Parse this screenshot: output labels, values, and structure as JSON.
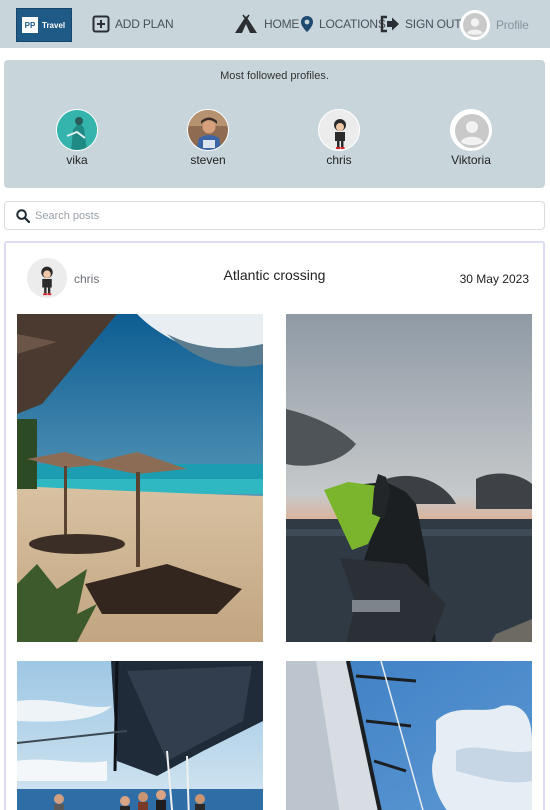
{
  "nav": {
    "logo_mark": "PP",
    "logo_text": "Travel",
    "add_plan": "ADD PLAN",
    "home": "HOME",
    "locations": "LOCATIONS",
    "sign_out": "SIGN OUT",
    "profile": "Profile"
  },
  "followed": {
    "title": "Most followed profiles.",
    "profiles": [
      {
        "name": "vika"
      },
      {
        "name": "steven"
      },
      {
        "name": "chris"
      },
      {
        "name": "Viktoria"
      }
    ]
  },
  "search": {
    "placeholder": "Search posts"
  },
  "post": {
    "author": "chris",
    "title": "Atlantic crossing",
    "date": "30 May 2023",
    "photos": [
      {
        "subject": "beach-umbrellas"
      },
      {
        "subject": "sunset-sea-hood"
      },
      {
        "subject": "sailboat-crew"
      },
      {
        "subject": "sail-sky"
      }
    ]
  },
  "colors": {
    "nav_bg": "#c8d6dc",
    "logo_bg": "#1f5a86",
    "nav_text": "#4a5158",
    "post_border": "#dcdcf4"
  },
  "icons": [
    "plus-square-icon",
    "tent-icon",
    "map-pin-icon",
    "sign-out-icon",
    "user-avatar-icon",
    "search-icon"
  ]
}
